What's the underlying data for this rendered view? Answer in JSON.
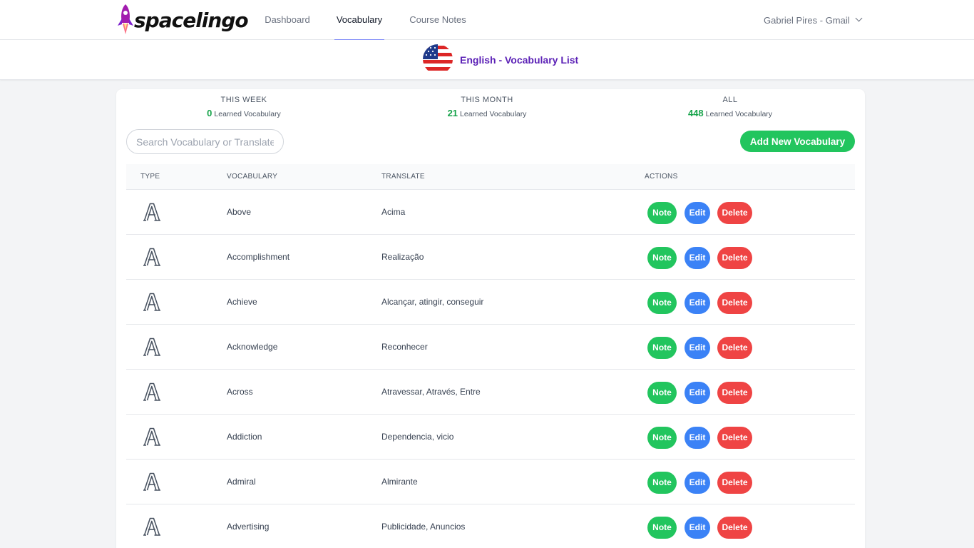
{
  "brand": {
    "logo_text": "spacelingo"
  },
  "nav": {
    "items": [
      {
        "label": "Dashboard"
      },
      {
        "label": "Vocabulary",
        "active": true
      },
      {
        "label": "Course Notes"
      }
    ],
    "user": "Gabriel Pires - Gmail"
  },
  "subheader": {
    "title": "English - Vocabulary List",
    "flag_icon": "us-flag-icon"
  },
  "stats": [
    {
      "label": "THIS WEEK",
      "value": "0",
      "text": "Learned Vocabulary"
    },
    {
      "label": "THIS MONTH",
      "value": "21",
      "text": "Learned Vocabulary"
    },
    {
      "label": "ALL",
      "value": "448",
      "text": "Learned Vocabulary"
    }
  ],
  "search": {
    "placeholder": "Search Vocabulary or Translate",
    "value": ""
  },
  "add_button": "Add New Vocabulary",
  "table": {
    "headers": [
      "TYPE",
      "VOCABULARY",
      "TRANSLATE",
      "ACTIONS"
    ],
    "type_icon": "letter-a-outline-icon",
    "actions": {
      "note": "Note",
      "edit": "Edit",
      "delete": "Delete"
    },
    "rows": [
      {
        "vocabulary": "Above",
        "translate": "Acima"
      },
      {
        "vocabulary": "Accomplishment",
        "translate": "Realização"
      },
      {
        "vocabulary": "Achieve",
        "translate": "Alcançar, atingir, conseguir"
      },
      {
        "vocabulary": "Acknowledge",
        "translate": "Reconhecer"
      },
      {
        "vocabulary": "Across",
        "translate": "Atravessar, Através, Entre"
      },
      {
        "vocabulary": "Addiction",
        "translate": "Dependencia, vicio"
      },
      {
        "vocabulary": "Admiral",
        "translate": "Almirante"
      },
      {
        "vocabulary": "Advertising",
        "translate": "Publicidade, Anuncios"
      }
    ]
  },
  "colors": {
    "accent": "#818cf8",
    "title_purple": "#5b21b6",
    "green": "#22c55e",
    "blue": "#3b82f6",
    "red": "#ef4444"
  }
}
